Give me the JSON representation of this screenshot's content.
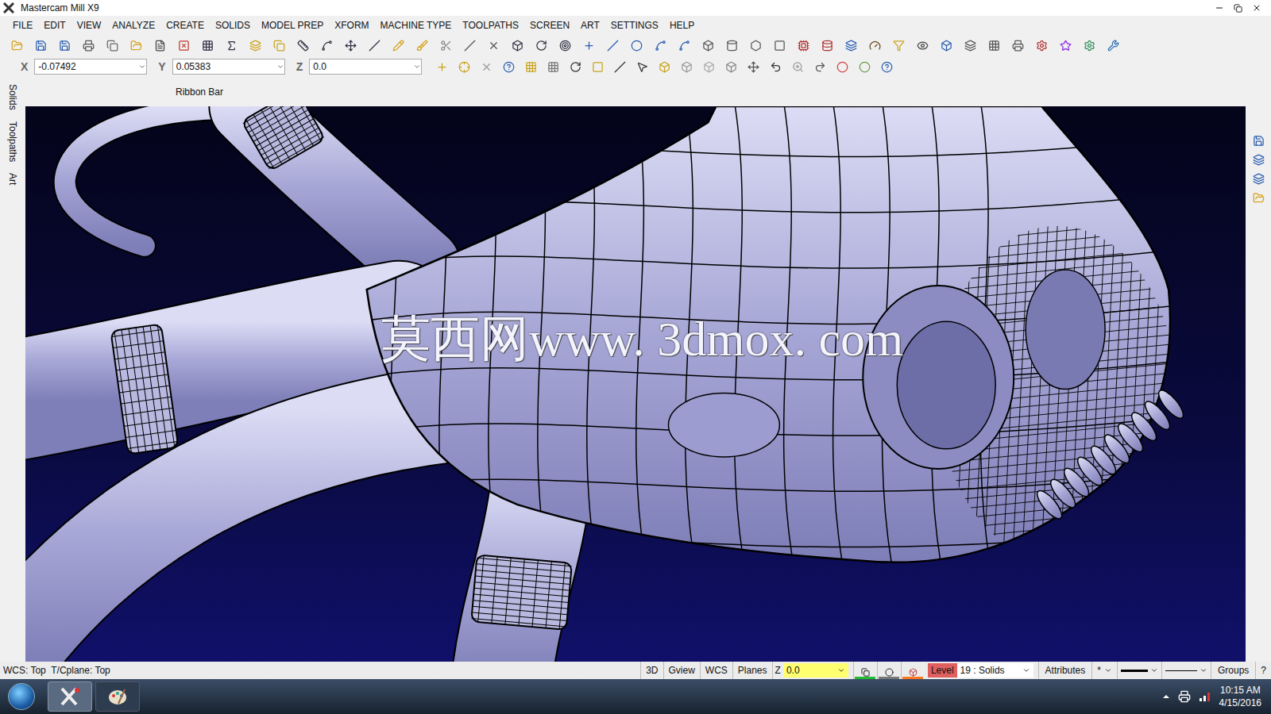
{
  "window": {
    "title": "Mastercam Mill X9"
  },
  "menu": [
    "FILE",
    "EDIT",
    "VIEW",
    "ANALYZE",
    "CREATE",
    "SOLIDS",
    "MODEL PREP",
    "XFORM",
    "MACHINE TYPE",
    "TOOLPATHS",
    "SCREEN",
    "ART",
    "SETTINGS",
    "HELP"
  ],
  "coordinates": [
    {
      "label": "X",
      "value": "-0.07492"
    },
    {
      "label": "Y",
      "value": "0.05383"
    },
    {
      "label": "Z",
      "value": "0.0"
    }
  ],
  "ribbon_bar": {
    "label": "Ribbon Bar"
  },
  "side_tabs": [
    {
      "label": "Solids",
      "selected": false
    },
    {
      "label": "Toolpaths",
      "selected": false
    },
    {
      "label": "Art",
      "selected": false
    }
  ],
  "viewport": {
    "watermark": "莫西网www. 3dmox. com"
  },
  "status_bar": {
    "plane_info": "WCS: Top  T/Cplane: Top",
    "buttons": [
      "3D",
      "Gview",
      "WCS",
      "Planes"
    ],
    "z_label": "Z",
    "z_value": "0.0",
    "level_label": "Level",
    "level_value": "19 : Solids",
    "attributes": "Attributes",
    "point_style": "*",
    "groups": "Groups",
    "help": "?"
  },
  "taskbar": {
    "time": "10:15 AM",
    "date": "4/15/2016"
  }
}
